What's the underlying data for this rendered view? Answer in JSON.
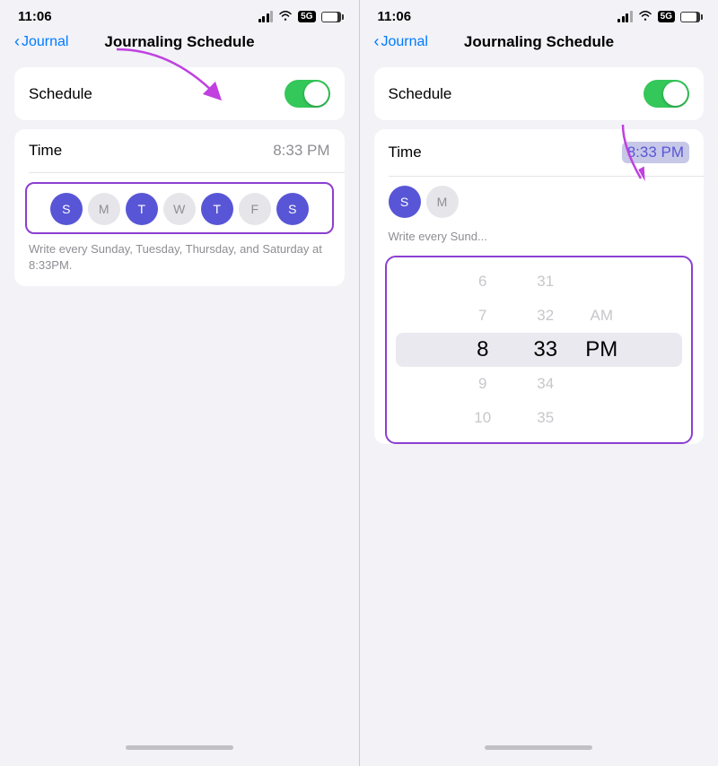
{
  "left_panel": {
    "status": {
      "time": "11:06"
    },
    "nav": {
      "back_label": "Journal",
      "title": "Journaling Schedule"
    },
    "schedule_section": {
      "label": "Schedule",
      "toggle_on": true
    },
    "time_section": {
      "label": "Time",
      "value": "8:33 PM"
    },
    "days": {
      "items": [
        {
          "label": "S",
          "active": true
        },
        {
          "label": "M",
          "active": false
        },
        {
          "label": "T",
          "active": true
        },
        {
          "label": "W",
          "active": false
        },
        {
          "label": "T",
          "active": true
        },
        {
          "label": "F",
          "active": false
        },
        {
          "label": "S",
          "active": true
        }
      ],
      "description": "Write every Sunday, Tuesday, Thursday, and Saturday at 8:33PM."
    }
  },
  "right_panel": {
    "status": {
      "time": "11:06"
    },
    "nav": {
      "back_label": "Journal",
      "title": "Journaling Schedule"
    },
    "schedule_section": {
      "label": "Schedule",
      "toggle_on": true
    },
    "time_section": {
      "label": "Time",
      "value": "8:33 PM",
      "highlighted": true
    },
    "days": {
      "items": [
        {
          "label": "S",
          "active": true
        },
        {
          "label": "M",
          "active": false
        }
      ],
      "description": "Write every Sund..."
    },
    "picker": {
      "hours": [
        "6",
        "7",
        "8",
        "9",
        "10"
      ],
      "minutes": [
        "31",
        "32",
        "33",
        "34",
        "35"
      ],
      "periods": [
        "AM",
        "PM"
      ],
      "selected_hour": "8",
      "selected_minute": "33",
      "selected_period": "PM"
    }
  }
}
